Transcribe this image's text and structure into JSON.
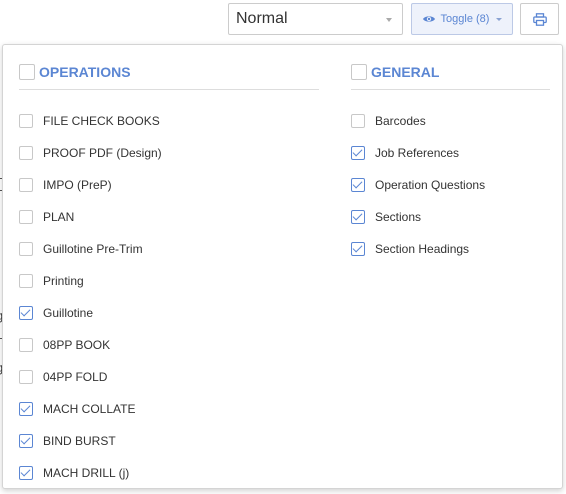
{
  "toolbar": {
    "view_select": {
      "value": "Normal"
    },
    "toggle_button": {
      "label": "Toggle (8)"
    },
    "print_button": {
      "icon": "printer-icon"
    },
    "accent_color": "#5b86d3"
  },
  "panel": {
    "operations": {
      "title": "OPERATIONS",
      "checked": false,
      "items": [
        {
          "label": "FILE CHECK BOOKS",
          "checked": false
        },
        {
          "label": "PROOF PDF (Design)",
          "checked": false
        },
        {
          "label": "IMPO (PreP)",
          "checked": false
        },
        {
          "label": "PLAN",
          "checked": false
        },
        {
          "label": "Guillotine Pre-Trim",
          "checked": false
        },
        {
          "label": "Printing",
          "checked": false
        },
        {
          "label": "Guillotine",
          "checked": true
        },
        {
          "label": "08PP BOOK",
          "checked": false
        },
        {
          "label": "04PP FOLD",
          "checked": false
        },
        {
          "label": "MACH COLLATE",
          "checked": true
        },
        {
          "label": "BIND BURST",
          "checked": true
        },
        {
          "label": "MACH DRILL (j)",
          "checked": true
        }
      ]
    },
    "general": {
      "title": "GENERAL",
      "checked": false,
      "items": [
        {
          "label": "Barcodes",
          "checked": false
        },
        {
          "label": "Job References",
          "checked": true
        },
        {
          "label": "Operation Questions",
          "checked": true
        },
        {
          "label": "Sections",
          "checked": true
        },
        {
          "label": "Section Headings",
          "checked": true
        }
      ]
    }
  }
}
